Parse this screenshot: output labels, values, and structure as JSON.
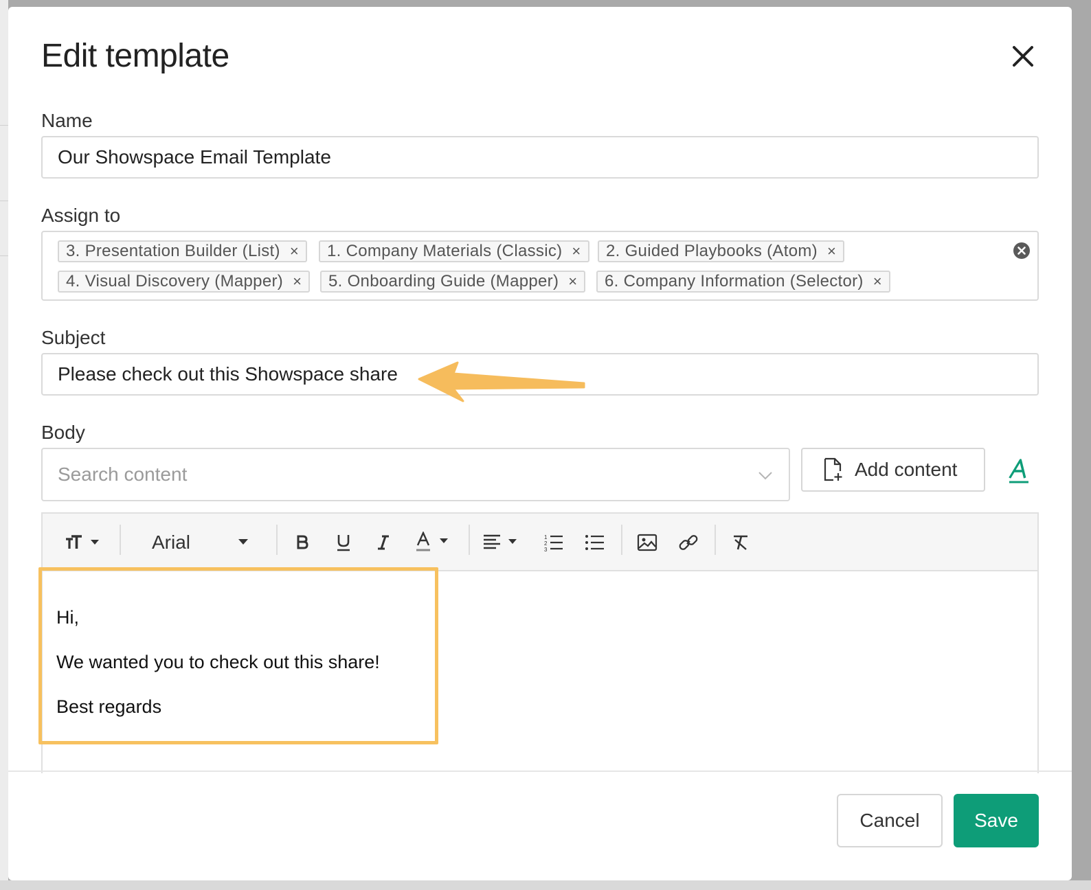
{
  "dialog": {
    "title": "Edit template",
    "close_icon": "close-icon"
  },
  "fields": {
    "name": {
      "label": "Name",
      "value": "Our Showspace Email Template"
    },
    "assign_to": {
      "label": "Assign to",
      "tags": [
        "3. Presentation Builder (List)",
        "1. Company Materials (Classic)",
        "2. Guided Playbooks (Atom)",
        "4. Visual Discovery (Mapper)",
        "5. Onboarding Guide (Mapper)",
        "6. Company Information (Selector)"
      ],
      "tag_remove": "×"
    },
    "subject": {
      "label": "Subject",
      "value": "Please check out this Showspace share"
    },
    "body": {
      "label": "Body",
      "search_placeholder": "Search content",
      "add_content_label": "Add content",
      "toolbar": {
        "font_family": "Arial",
        "icons": [
          "text-size-icon",
          "bold-icon",
          "underline-icon",
          "italic-icon",
          "font-color-icon",
          "align-icon",
          "ordered-list-icon",
          "unordered-list-icon",
          "image-icon",
          "link-icon",
          "clear-format-icon"
        ]
      },
      "content": [
        "Hi,",
        "We wanted you to check out this share!",
        "Best regards"
      ]
    }
  },
  "footer": {
    "cancel_label": "Cancel",
    "save_label": "Save"
  },
  "colors": {
    "accent": "#0e9d78",
    "highlight": "#f7c15f",
    "annotation_arrow": "#f6bc5c"
  }
}
